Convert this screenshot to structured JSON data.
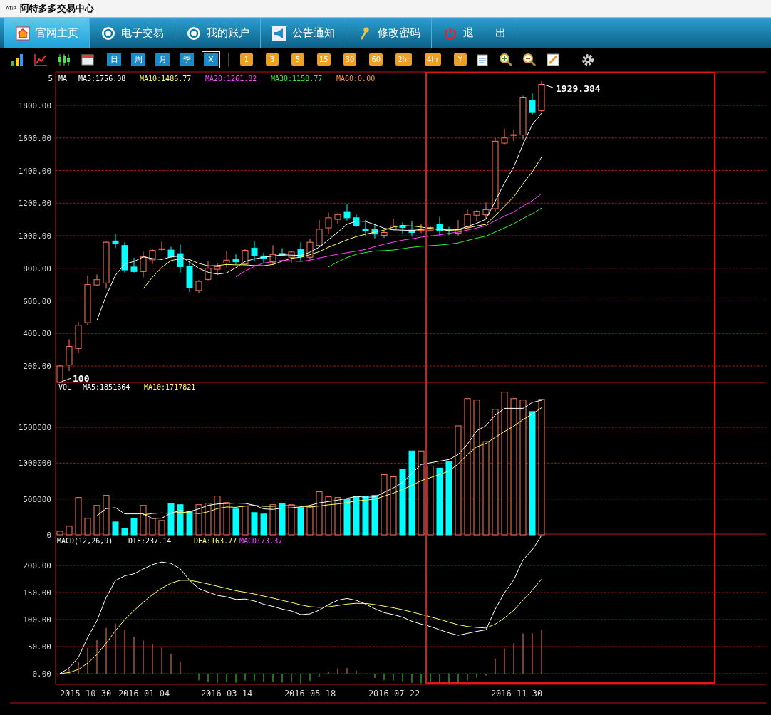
{
  "window": {
    "logo": "ATiP",
    "title": "阿特多多交易中心"
  },
  "nav_tabs": [
    {
      "label": "官网主页",
      "selected": true
    },
    {
      "label": "电子交易",
      "selected": false
    },
    {
      "label": "我的账户",
      "selected": false
    },
    {
      "label": "公告通知",
      "selected": false
    },
    {
      "label": "修改密码",
      "selected": false
    },
    {
      "label": "退　　出",
      "selected": false
    }
  ],
  "toolbar": {
    "period_buttons": [
      {
        "label": "日",
        "selected": false
      },
      {
        "label": "周",
        "selected": false
      },
      {
        "label": "月",
        "selected": false
      },
      {
        "label": "季",
        "selected": false
      },
      {
        "label": "X",
        "selected": true
      }
    ],
    "minute_buttons": [
      "1",
      "3",
      "5",
      "15",
      "30",
      "60",
      "2hr",
      "4hr",
      "Y"
    ]
  },
  "price_panel": {
    "corner_label": "5",
    "legend": [
      {
        "label": "MA",
        "color": "#ffffff"
      },
      {
        "label": "MA5:1756.08",
        "color": "#ffffff"
      },
      {
        "label": "MA10:1486.77",
        "color": "#ffff66"
      },
      {
        "label": "MA20:1261.82",
        "color": "#ff44ff"
      },
      {
        "label": "MA30:1158.77",
        "color": "#33ee33"
      },
      {
        "label": "MA60:0.00",
        "color": "#ff8844"
      }
    ],
    "y_ticks": [
      "1800.00",
      "1600.00",
      "1400.00",
      "1200.00",
      "1000.00",
      "800.00",
      "600.00",
      "400.00",
      "200.00"
    ],
    "high_label": "1929.384",
    "low_label": "100"
  },
  "volume_panel": {
    "legend": [
      {
        "label": "VOL",
        "color": "#ffffff"
      },
      {
        "label": "MA5:1851664",
        "color": "#ffffff"
      },
      {
        "label": "MA10:1717821",
        "color": "#ffff66"
      }
    ],
    "y_ticks": [
      "1500000",
      "1000000",
      "500000",
      "0"
    ]
  },
  "macd_panel": {
    "legend": [
      {
        "label": "MACD(12,26,9)",
        "color": "#ffffff"
      },
      {
        "label": "DIF:237.14",
        "color": "#ffffff"
      },
      {
        "label": "DEA:163.77",
        "color": "#ffff66"
      },
      {
        "label": "MACD:73.37",
        "color": "#ff44ff"
      }
    ],
    "y_ticks": [
      "200.00",
      "150.00",
      "100.00",
      "50.00",
      "0.00"
    ]
  },
  "x_labels": [
    "2015-10-30",
    "2016-01-04",
    "2016-03-14",
    "2016-05-18",
    "2016-07-22",
    "2016-11-30"
  ]
}
